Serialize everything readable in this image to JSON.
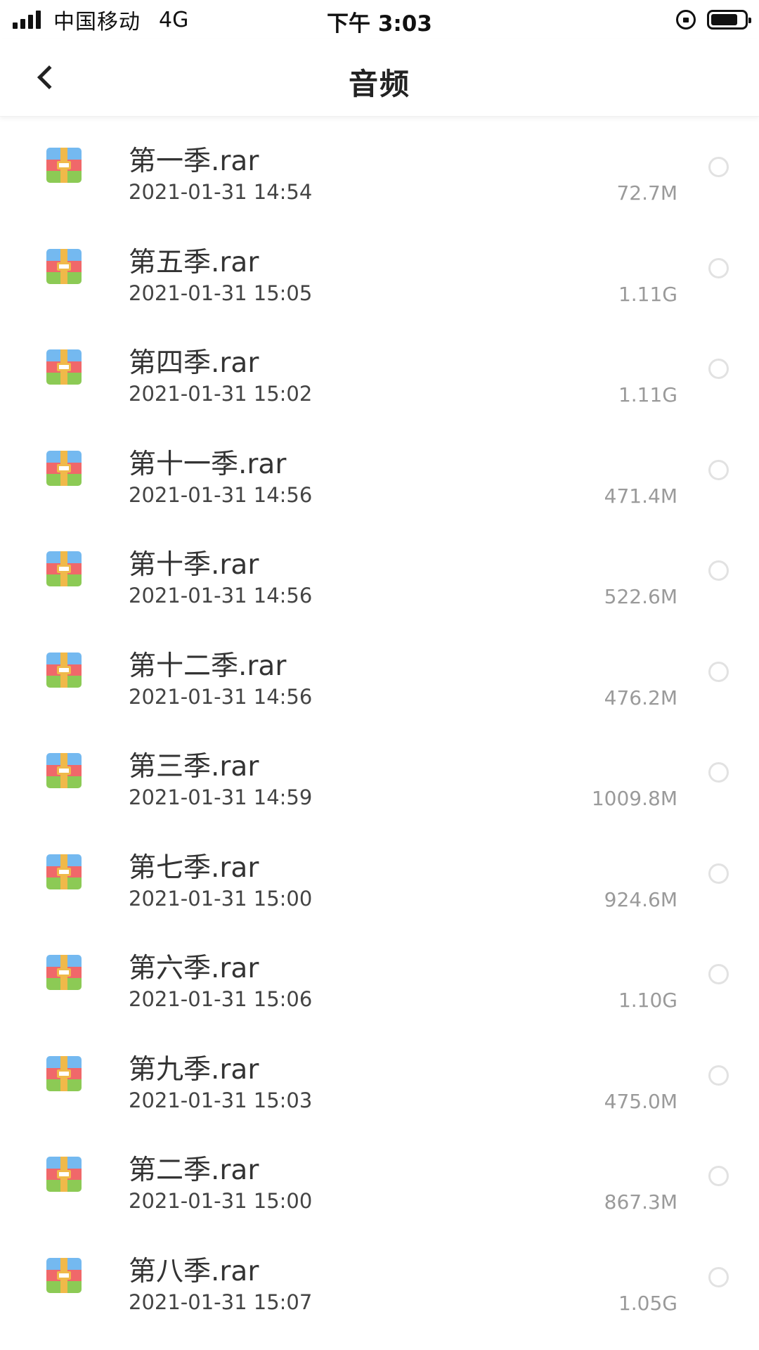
{
  "status_bar": {
    "carrier": "中国移动",
    "network": "4G",
    "time": "下午 3:03"
  },
  "nav": {
    "title": "音频"
  },
  "files": [
    {
      "name": "第一季.rar",
      "date": "2021-01-31 14:54",
      "size": "72.7M"
    },
    {
      "name": "第五季.rar",
      "date": "2021-01-31 15:05",
      "size": "1.11G"
    },
    {
      "name": "第四季.rar",
      "date": "2021-01-31 15:02",
      "size": "1.11G"
    },
    {
      "name": "第十一季.rar",
      "date": "2021-01-31 14:56",
      "size": "471.4M"
    },
    {
      "name": "第十季.rar",
      "date": "2021-01-31 14:56",
      "size": "522.6M"
    },
    {
      "name": "第十二季.rar",
      "date": "2021-01-31 14:56",
      "size": "476.2M"
    },
    {
      "name": "第三季.rar",
      "date": "2021-01-31 14:59",
      "size": "1009.8M"
    },
    {
      "name": "第七季.rar",
      "date": "2021-01-31 15:00",
      "size": "924.6M"
    },
    {
      "name": "第六季.rar",
      "date": "2021-01-31 15:06",
      "size": "1.10G"
    },
    {
      "name": "第九季.rar",
      "date": "2021-01-31 15:03",
      "size": "475.0M"
    },
    {
      "name": "第二季.rar",
      "date": "2021-01-31 15:00",
      "size": "867.3M"
    },
    {
      "name": "第八季.rar",
      "date": "2021-01-31 15:07",
      "size": "1.05G"
    }
  ],
  "icons": {
    "file_icon": "archive-icon",
    "back": "chevron-left-icon",
    "select": "radio-circle-icon"
  },
  "colors": {
    "archive_blue": "#74b9f0",
    "archive_red": "#f0686a",
    "archive_green": "#8cca55",
    "archive_strap": "#f0b94a"
  }
}
